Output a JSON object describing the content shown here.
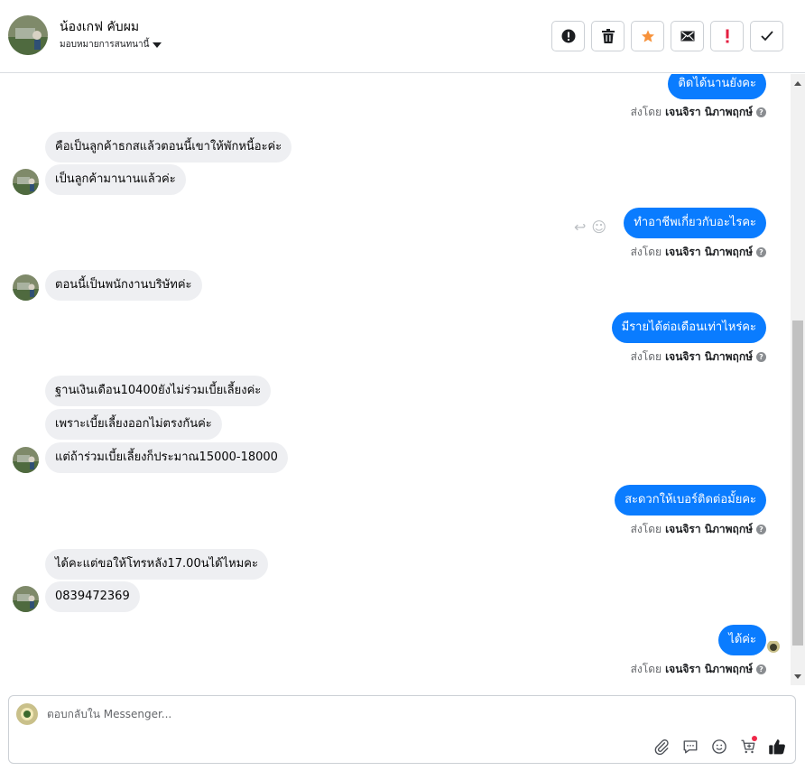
{
  "header": {
    "contact_name": "น้องเกฟ คับผม",
    "assign_label": "มอบหมายการสนทนานี้",
    "actions": [
      {
        "name": "spam-button",
        "icon": "alert-circle-icon"
      },
      {
        "name": "delete-button",
        "icon": "trash-icon"
      },
      {
        "name": "star-button",
        "icon": "star-icon"
      },
      {
        "name": "mark-unread-button",
        "icon": "envelope-icon"
      },
      {
        "name": "follow-up-button",
        "icon": "exclamation-icon"
      },
      {
        "name": "done-button",
        "icon": "check-icon"
      }
    ]
  },
  "colors": {
    "accent": "#0a7cff",
    "incoming_bubble": "#eeeff2",
    "star": "#f7923b",
    "follow_up": "#e41e3f"
  },
  "thread": {
    "sent_by_prefix": "ส่งโดย",
    "sender": "เจนจิรา นิภาพฤกษ์",
    "messages": [
      {
        "dir": "out",
        "text": "ติดได้นานยังคะ"
      },
      {
        "dir": "in",
        "text": "คือเป็นลูกค้าธกสแล้วตอนนี้เขาให้พักหนี้อะค่ะ"
      },
      {
        "dir": "in",
        "text": "เป็นลูกค้ามานานแล้วค่ะ"
      },
      {
        "dir": "out",
        "text": "ทำอาชีพเกี่ยวกับอะไรคะ"
      },
      {
        "dir": "in",
        "text": "ตอนนี้เป็นพนักงานบริษัทค่ะ"
      },
      {
        "dir": "out",
        "text": "มีรายได้ต่อเดือนเท่าไหร่คะ"
      },
      {
        "dir": "in",
        "text": "ฐานเงินเดือน10400ยังไม่ร่วมเบี้ยเลี้ยงค่ะ"
      },
      {
        "dir": "in",
        "text": "เพราะเบี้ยเลี้ยงออกไม่ตรงกันค่ะ"
      },
      {
        "dir": "in",
        "text": "แต่ถ้าร่วมเบี้ยเลี้ยงก็ประมาณ15000-18000"
      },
      {
        "dir": "out",
        "text": "สะดวกให้เบอร์ติดต่อมั้ยคะ"
      },
      {
        "dir": "in",
        "text": "ได้คะแต่ขอให้โทรหลัง17.00นได้ไหมคะ"
      },
      {
        "dir": "in",
        "text": "0839472369"
      },
      {
        "dir": "out",
        "text": "ได้ค่ะ"
      }
    ]
  },
  "composer": {
    "placeholder": "ตอบกลับใน Messenger...",
    "tools": [
      "paperclip-icon",
      "saved-replies-icon",
      "emoji-icon",
      "cart-icon",
      "thumbs-up-icon"
    ]
  }
}
